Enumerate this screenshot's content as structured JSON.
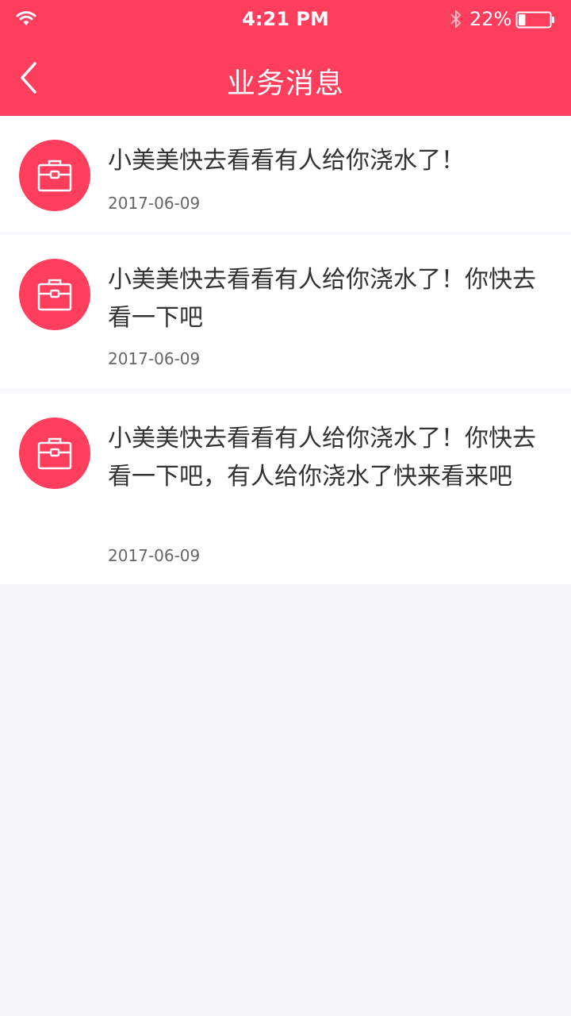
{
  "status_bar": {
    "time": "4:21 PM",
    "battery_percent": "22%",
    "battery_level": 0.22,
    "icons": [
      "wifi-icon",
      "bluetooth-icon",
      "battery-icon"
    ]
  },
  "nav": {
    "title": "业务消息",
    "back_icon": "chevron-left-icon"
  },
  "colors": {
    "accent": "#ff3d5c",
    "text_primary": "#333333",
    "text_secondary": "#666666",
    "divider": "#eeeeee",
    "card_background": "#ffffff",
    "page_background": "#f6f6fb"
  },
  "messages": [
    {
      "icon": "briefcase-icon",
      "text": "小美美快去看看有人给你浇水了！",
      "date": "2017-06-09"
    },
    {
      "icon": "briefcase-icon",
      "text": "小美美快去看看有人给你浇水了！你快去看一下吧",
      "date": "2017-06-09"
    },
    {
      "icon": "briefcase-icon",
      "text": "小美美快去看看有人给你浇水了！你快去看一下吧，有人给你浇水了快来看来吧",
      "date": "2017-06-09"
    }
  ]
}
